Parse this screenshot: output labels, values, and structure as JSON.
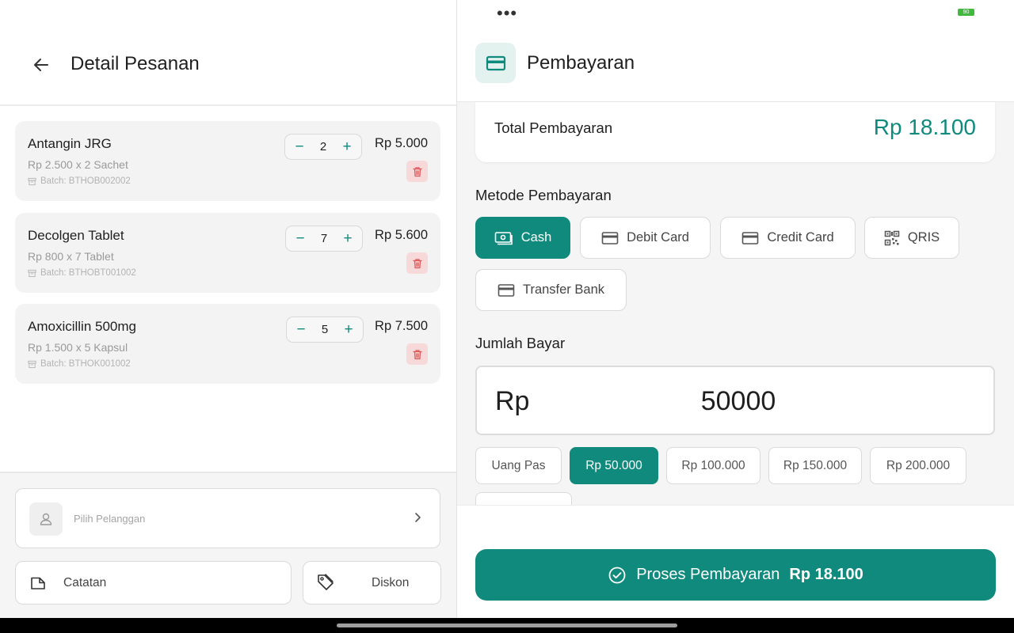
{
  "left": {
    "title": "Detail Pesanan",
    "items": [
      {
        "name": "Antangin JRG",
        "detail": "Rp 2.500 x 2 Sachet",
        "batch": "Batch: BTHOB002002",
        "qty": "2",
        "price": "Rp 5.000"
      },
      {
        "name": "Decolgen Tablet",
        "detail": "Rp 800 x 7 Tablet",
        "batch": "Batch: BTHOBT001002",
        "qty": "7",
        "price": "Rp 5.600"
      },
      {
        "name": "Amoxicillin 500mg",
        "detail": "Rp 1.500 x 5 Kapsul",
        "batch": "Batch: BTHOK001002",
        "qty": "5",
        "price": "Rp 7.500"
      }
    ],
    "stepper": {
      "minus": "−",
      "plus": "+"
    },
    "customer_placeholder": "Pilih Pelanggan",
    "note_label": "Catatan",
    "discount_label": "Diskon"
  },
  "status_bar": {
    "menu_dots": "•••",
    "battery": "90",
    "battery_color": "#43b83e"
  },
  "right": {
    "title": "Pembayaran",
    "total_label": "Total Pembayaran",
    "total_value": "Rp 18.100",
    "method_title": "Metode Pembayaran",
    "methods": [
      {
        "label": "Cash",
        "icon": "cash-icon",
        "selected": true
      },
      {
        "label": "Debit Card",
        "icon": "card-icon",
        "selected": false
      },
      {
        "label": "Credit Card",
        "icon": "card-icon",
        "selected": false
      },
      {
        "label": "QRIS",
        "icon": "qr-icon",
        "selected": false
      },
      {
        "label": "Transfer Bank",
        "icon": "card-icon",
        "selected": false
      }
    ],
    "amount_title": "Jumlah Bayar",
    "amount_prefix": "Rp",
    "amount_value": "50000",
    "quick_amounts": [
      {
        "label": "Uang Pas",
        "selected": false
      },
      {
        "label": "Rp 50.000",
        "selected": true
      },
      {
        "label": "Rp 100.000",
        "selected": false
      },
      {
        "label": "Rp 150.000",
        "selected": false
      },
      {
        "label": "Rp 200.000",
        "selected": false
      }
    ],
    "process_label": "Proses Pembayaran",
    "process_amount": "Rp 18.100"
  },
  "colors": {
    "accent": "#0f8a7d",
    "accent_light": "#e3f2ef",
    "danger": "#e05555",
    "danger_bg": "#f7d9d9"
  }
}
